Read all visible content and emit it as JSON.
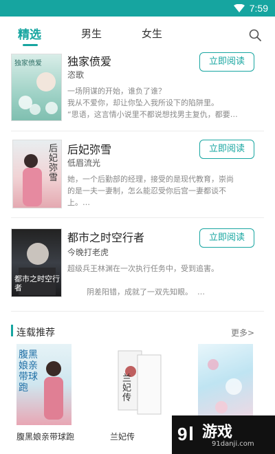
{
  "status": {
    "time": "7:59"
  },
  "tabs": [
    {
      "label": "精选",
      "active": true
    },
    {
      "label": "男生",
      "active": false
    },
    {
      "label": "女生",
      "active": false
    }
  ],
  "books": [
    {
      "title": "独家偾爱",
      "author": "恣歌",
      "desc": [
        "一场阴谋的开始，谁负了谁？",
        "我从不爱你，却让你坠入我所设下的陷阱里。",
        "“思语，这言情小说里不都说想找男主复仇，都要…"
      ],
      "button": "立即阅读",
      "cover_text": "独家偾爱"
    },
    {
      "title": "后妃弥雪",
      "author": "低眉流光",
      "desc": [
        "她，一个后勤部的经理，接受的是现代教育，崇尚",
        "的是一夫一妻制，怎么能忍受你后宫一妻都谈不",
        "上。…"
      ],
      "button": "立即阅读",
      "cover_text": "后妃弥雪"
    },
    {
      "title": "都市之时空行者",
      "author": "今晚打老虎",
      "desc": [
        "超级兵王林渊在一次执行任务中，受到追害。",
        "",
        "        阴差阳错，成就了一双先知眼。  …"
      ],
      "button": "立即阅读",
      "cover_text": "都市之时空行者"
    }
  ],
  "section": {
    "title": "连载推荐",
    "more": "更多>"
  },
  "recommend": [
    {
      "name": "腹黑娘亲带球跑",
      "cover_text": "腹黑娘亲带球跑"
    },
    {
      "name": "兰妃传",
      "cover_text": "兰妃传"
    },
    {
      "name": "",
      "cover_text": ""
    }
  ],
  "watermark": {
    "main": "游戏",
    "sub": "91danji.com"
  },
  "colors": {
    "accent": "#16a5a0"
  }
}
